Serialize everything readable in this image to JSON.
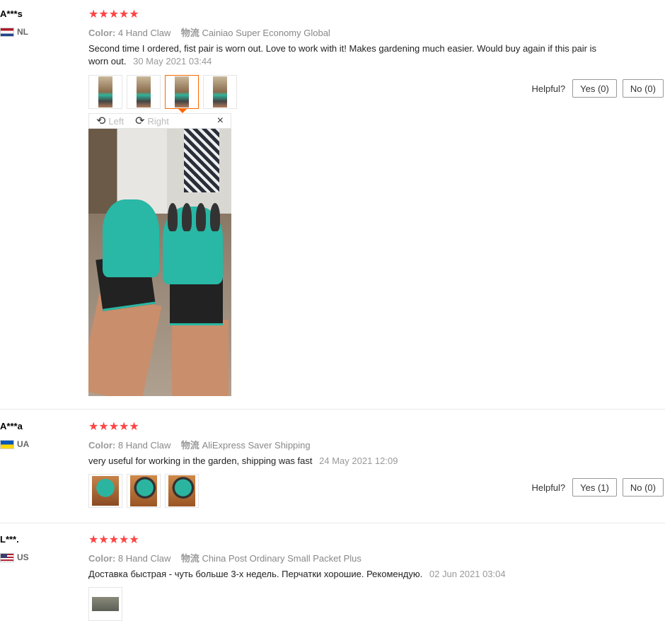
{
  "labels": {
    "color": "Color:",
    "shipping": "物流",
    "helpful": "Helpful?"
  },
  "stars": "★★★★★",
  "reviews": [
    {
      "user": "A***s",
      "country": "NL",
      "color_value": "4 Hand Claw",
      "shipping_value": "Cainiao Super Economy Global",
      "text": "Second time I ordered, fist pair is worn out. Love to work with it! Makes gardening much easier. Would buy again if this pair is worn out.",
      "date": "30 May 2021 03:44",
      "yes": "Yes (0)",
      "no": "No (0)",
      "viewer": {
        "left": "Left",
        "right": "Right",
        "close": "×"
      }
    },
    {
      "user": "A***a",
      "country": "UA",
      "color_value": "8 Hand Claw",
      "shipping_value": "AliExpress Saver Shipping",
      "text": "very useful for working in the garden, shipping was fast",
      "date": "24 May 2021 12:09",
      "yes": "Yes (1)",
      "no": "No (0)"
    },
    {
      "user": "L***.",
      "country": "US",
      "color_value": "8 Hand Claw",
      "shipping_value": "China Post Ordinary Small Packet Plus",
      "text": "Доставка быстрая - чуть больше 3-х недель. Перчатки хорошие. Рекомендую.",
      "date": "02 Jun 2021 03:04"
    }
  ]
}
